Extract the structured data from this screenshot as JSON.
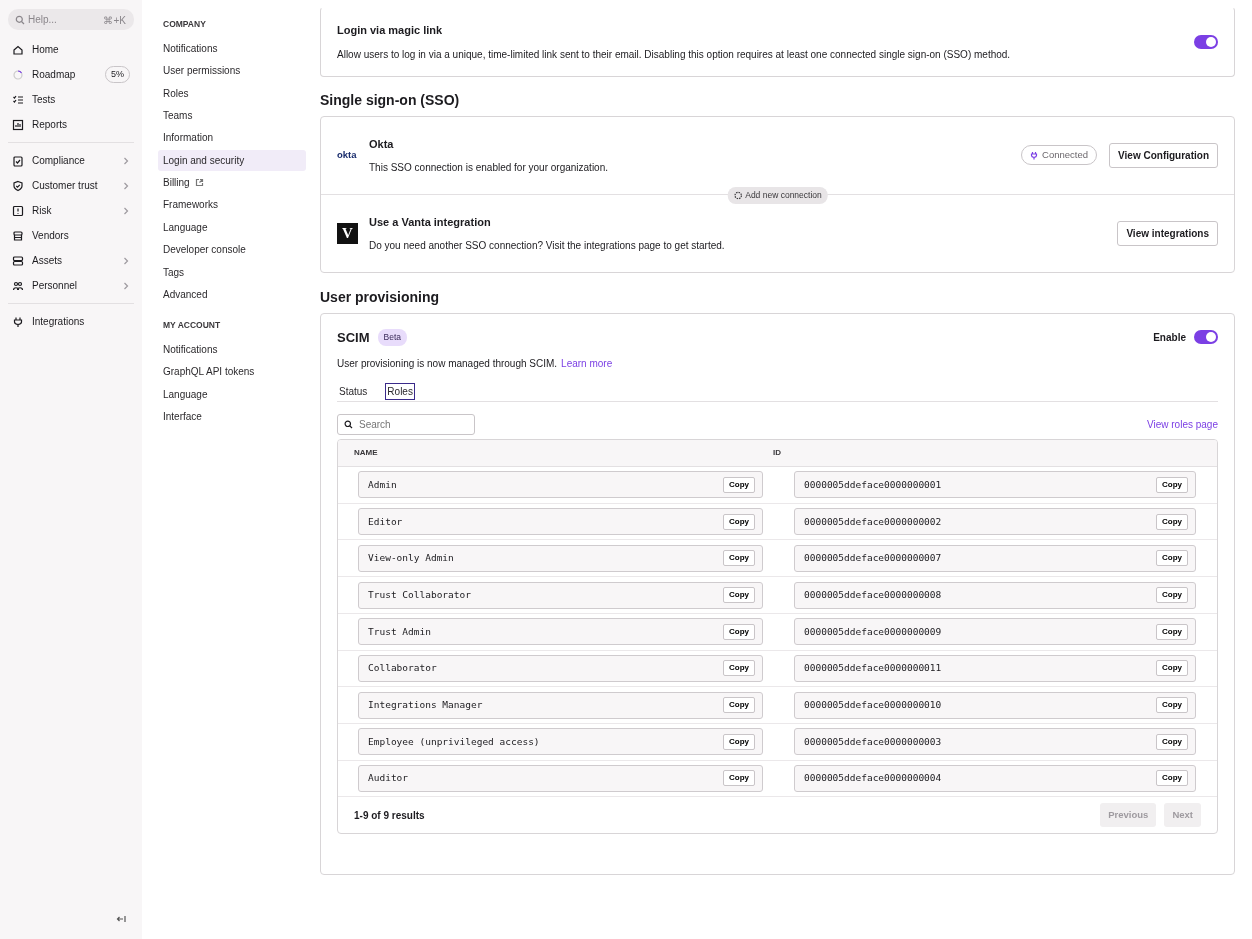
{
  "sidebar": {
    "search": {
      "placeholder": "Help...",
      "shortcut": "⌘+K"
    },
    "groups": [
      [
        {
          "label": "Home"
        },
        {
          "label": "Roadmap",
          "badge": "5%"
        },
        {
          "label": "Tests"
        },
        {
          "label": "Reports"
        }
      ],
      [
        {
          "label": "Compliance",
          "expandable": true
        },
        {
          "label": "Customer trust",
          "expandable": true
        },
        {
          "label": "Risk",
          "expandable": true
        },
        {
          "label": "Vendors"
        },
        {
          "label": "Assets",
          "expandable": true
        },
        {
          "label": "Personnel",
          "expandable": true
        }
      ],
      [
        {
          "label": "Integrations"
        }
      ]
    ]
  },
  "settings_nav": [
    {
      "heading": "COMPANY",
      "items": [
        {
          "label": "Notifications",
          "selected": false
        },
        {
          "label": "User permissions",
          "selected": false
        },
        {
          "label": "Roles",
          "selected": false
        },
        {
          "label": "Teams",
          "selected": false
        },
        {
          "label": "Information",
          "selected": false
        },
        {
          "label": "Login and security",
          "selected": true
        },
        {
          "label": "Billing",
          "selected": false,
          "external": true
        },
        {
          "label": "Frameworks",
          "selected": false
        },
        {
          "label": "Language",
          "selected": false
        },
        {
          "label": "Developer console",
          "selected": false
        },
        {
          "label": "Tags",
          "selected": false
        },
        {
          "label": "Advanced",
          "selected": false
        }
      ]
    },
    {
      "heading": "MY ACCOUNT",
      "items": [
        {
          "label": "Notifications",
          "selected": false
        },
        {
          "label": "GraphQL API tokens",
          "selected": false
        },
        {
          "label": "Language",
          "selected": false
        },
        {
          "label": "Interface",
          "selected": false
        }
      ]
    }
  ],
  "magic_link": {
    "title": "Login via magic link",
    "description": "Allow users to log in via a unique, time-limited link sent to their email. Disabling this option requires at least one connected single sign-on (SSO) method.",
    "on": true
  },
  "sso": {
    "heading": "Single sign-on (SSO)",
    "connections": [
      {
        "kind": "okta",
        "logo": "okta",
        "name": "Okta",
        "description": "This SSO connection is enabled for your organization.",
        "status": "Connected",
        "button": "View Configuration"
      },
      {
        "kind": "vanta",
        "logo": "V",
        "name": "Use a Vanta integration",
        "description": "Do you need another SSO connection? Visit the integrations page to get started.",
        "button": "View integrations"
      }
    ],
    "divider_label": "Add new connection"
  },
  "provisioning": {
    "heading": "User provisioning",
    "title": "SCIM",
    "badge": "Beta",
    "toggle_label": "Enable",
    "on": true,
    "description": "User provisioning is now managed through SCIM.",
    "link": "Learn more",
    "tabs": [
      {
        "label": "Status",
        "selected": false
      },
      {
        "label": "Roles",
        "selected": true
      }
    ],
    "search": {
      "placeholder": "Search"
    },
    "roles_link": "View roles page",
    "table": {
      "columns": [
        "NAME",
        "ID"
      ],
      "rows": [
        {
          "name": "Admin",
          "name_copy": "Copy",
          "id": "0000005ddeface0000000001",
          "id_copy": "Copy"
        },
        {
          "name": "Editor",
          "name_copy": "Copy",
          "id": "0000005ddeface0000000002",
          "id_copy": "Copy"
        },
        {
          "name": "View-only Admin",
          "name_copy": "Copy",
          "id": "0000005ddeface0000000007",
          "id_copy": "Copy"
        },
        {
          "name": "Trust Collaborator",
          "name_copy": "Copy",
          "id": "0000005ddeface0000000008",
          "id_copy": "Copy"
        },
        {
          "name": "Trust Admin",
          "name_copy": "Copy",
          "id": "0000005ddeface0000000009",
          "id_copy": "Copy"
        },
        {
          "name": "Collaborator",
          "name_copy": "Copy",
          "id": "0000005ddeface0000000011",
          "id_copy": "Copy"
        },
        {
          "name": "Integrations Manager",
          "name_copy": "Copy",
          "id": "0000005ddeface0000000010",
          "id_copy": "Copy"
        },
        {
          "name": "Employee (unprivileged access)",
          "name_copy": "Copy",
          "id": "0000005ddeface0000000003",
          "id_copy": "Copy"
        },
        {
          "name": "Auditor",
          "name_copy": "Copy",
          "id": "0000005ddeface0000000004",
          "id_copy": "Copy"
        }
      ]
    },
    "results": "1-9 of 9 results",
    "pager": [
      {
        "label": "Previous",
        "disabled": true
      },
      {
        "label": "Next",
        "disabled": true
      }
    ]
  }
}
